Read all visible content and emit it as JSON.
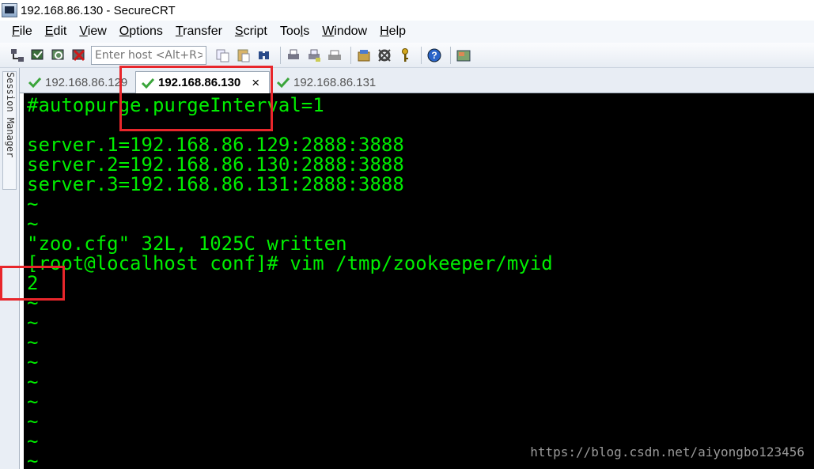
{
  "window": {
    "title": "192.168.86.130 - SecureCRT"
  },
  "menu": [
    {
      "label": "File",
      "u": "F",
      "rest": "ile"
    },
    {
      "label": "Edit",
      "u": "E",
      "rest": "dit"
    },
    {
      "label": "View",
      "u": "V",
      "rest": "iew"
    },
    {
      "label": "Options",
      "u": "O",
      "rest": "ptions"
    },
    {
      "label": "Transfer",
      "u": "T",
      "rest": "ransfer"
    },
    {
      "label": "Script",
      "u": "S",
      "rest": "cript"
    },
    {
      "label": "Tools",
      "pre": "Too",
      "u": "l",
      "rest": "s"
    },
    {
      "label": "Window",
      "u": "W",
      "rest": "indow"
    },
    {
      "label": "Help",
      "u": "H",
      "rest": "elp"
    }
  ],
  "toolbar": {
    "quick_connect_placeholder": "Enter host <Alt+R>",
    "icons": [
      "connect-icon",
      "quick-connect-icon",
      "reconnect-icon",
      "disconnect-icon",
      "copy-icon",
      "paste-icon",
      "find-icon",
      "print-icon",
      "print-setup-icon",
      "log-icon",
      "session-options-icon",
      "global-options-icon",
      "key-icon",
      "help-icon",
      "sftp-icon"
    ]
  },
  "sidebar": {
    "label": "Session Manager"
  },
  "tabs": [
    {
      "label": "192.168.86.129",
      "active": false
    },
    {
      "label": "192.168.86.130",
      "active": true,
      "close": "×"
    },
    {
      "label": "192.168.86.131",
      "active": false
    }
  ],
  "terminal": {
    "lines": [
      "#autopurge.purgeInterval=1",
      "",
      "server.1=192.168.86.129:2888:3888",
      "server.2=192.168.86.130:2888:3888",
      "server.3=192.168.86.131:2888:3888",
      "~",
      "~",
      "\"zoo.cfg\" 32L, 1025C written",
      "[root@localhost conf]# vim /tmp/zookeeper/myid",
      "2",
      "~",
      "~",
      "~",
      "~",
      "~",
      "~",
      "~",
      "~",
      "~"
    ]
  },
  "colors": {
    "terminal_fg": "#00ee00",
    "terminal_bg": "#000000",
    "annotation": "#e8262b"
  },
  "watermark": "https://blog.csdn.net/aiyongbo123456"
}
